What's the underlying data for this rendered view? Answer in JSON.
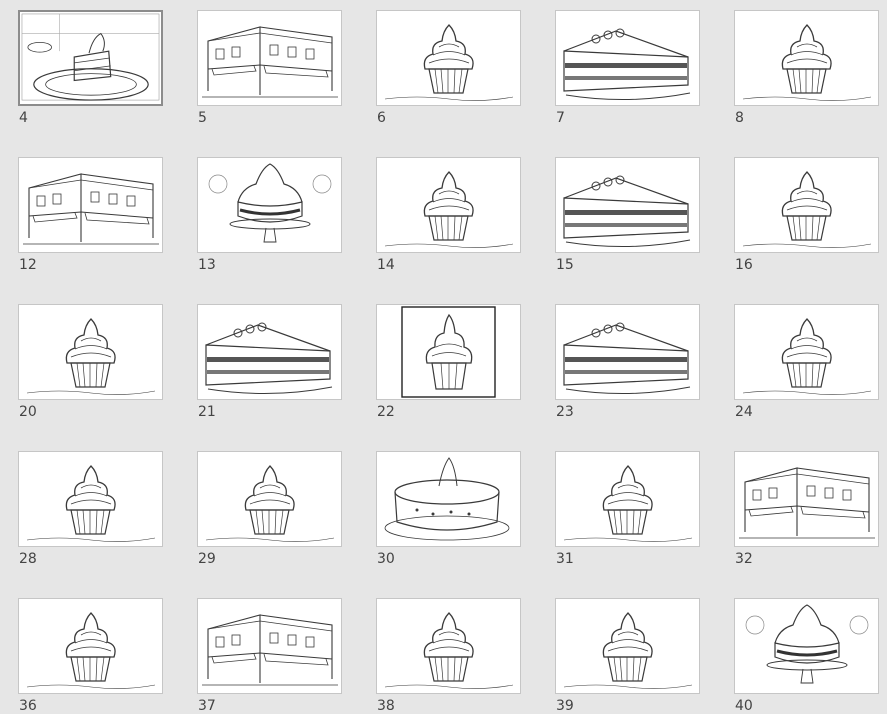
{
  "slides": [
    {
      "number": "4",
      "picture": "cake-slice-plate-icon",
      "selected": true
    },
    {
      "number": "5",
      "picture": "storefront-corner-icon"
    },
    {
      "number": "6",
      "picture": "cupcake-icon"
    },
    {
      "number": "7",
      "picture": "layer-cake-slice-icon"
    },
    {
      "number": "8",
      "picture": "cupcake-icon"
    },
    {
      "number": "12",
      "picture": "storefront-corner-icon"
    },
    {
      "number": "13",
      "picture": "cake-stand-icon"
    },
    {
      "number": "14",
      "picture": "cupcake-icon"
    },
    {
      "number": "15",
      "picture": "layer-cake-slice-icon"
    },
    {
      "number": "16",
      "picture": "cupcake-icon"
    },
    {
      "number": "20",
      "picture": "cupcake-icon"
    },
    {
      "number": "21",
      "picture": "layer-cake-slice-icon"
    },
    {
      "number": "22",
      "picture": "framed-cupcake-icon"
    },
    {
      "number": "23",
      "picture": "layer-cake-slice-icon"
    },
    {
      "number": "24",
      "picture": "cupcake-icon"
    },
    {
      "number": "28",
      "picture": "cupcake-icon"
    },
    {
      "number": "29",
      "picture": "cupcake-icon"
    },
    {
      "number": "30",
      "picture": "round-cake-icon"
    },
    {
      "number": "31",
      "picture": "cupcake-icon"
    },
    {
      "number": "32",
      "picture": "storefront-corner-icon"
    },
    {
      "number": "36",
      "picture": "cupcake-icon"
    },
    {
      "number": "37",
      "picture": "storefront-corner-icon"
    },
    {
      "number": "38",
      "picture": "cupcake-icon"
    },
    {
      "number": "39",
      "picture": "cupcake-icon"
    },
    {
      "number": "40",
      "picture": "cake-stand-icon"
    }
  ],
  "colors": {
    "background": "#e6e6e6",
    "line_art": "#3a3a3a",
    "selection_border": "#8c8c8c"
  }
}
